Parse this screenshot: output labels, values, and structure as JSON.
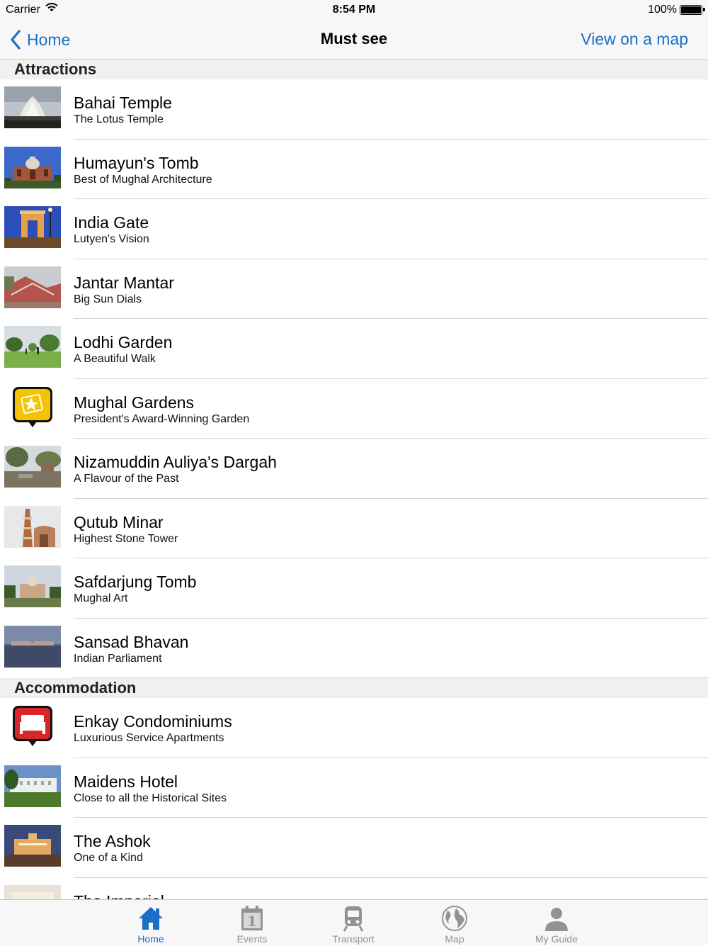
{
  "status": {
    "carrier": "Carrier",
    "time": "8:54 PM",
    "battery": "100%"
  },
  "nav": {
    "back_label": "Home",
    "title": "Must see",
    "right_label": "View on a map"
  },
  "sections": [
    {
      "title": "Attractions",
      "items": [
        {
          "title": "Bahai Temple",
          "subtitle": "The Lotus Temple",
          "thumb": "lotus-temple-photo"
        },
        {
          "title": "Humayun's Tomb",
          "subtitle": "Best of Mughal Architecture",
          "thumb": "humayun-tomb-photo"
        },
        {
          "title": "India Gate",
          "subtitle": "Lutyen's Vision",
          "thumb": "india-gate-photo"
        },
        {
          "title": "Jantar Mantar",
          "subtitle": "Big Sun Dials",
          "thumb": "jantar-mantar-photo"
        },
        {
          "title": "Lodhi Garden",
          "subtitle": "A Beautiful Walk",
          "thumb": "lodhi-garden-photo"
        },
        {
          "title": "Mughal Gardens",
          "subtitle": "President's Award-Winning Garden",
          "thumb": "attraction-pin-icon"
        },
        {
          "title": "Nizamuddin Auliya's Dargah",
          "subtitle": "A Flavour of the Past",
          "thumb": "dargah-photo"
        },
        {
          "title": "Qutub Minar",
          "subtitle": "Highest Stone Tower",
          "thumb": "qutub-minar-photo"
        },
        {
          "title": "Safdarjung Tomb",
          "subtitle": "Mughal Art",
          "thumb": "safdarjung-tomb-photo"
        },
        {
          "title": "Sansad Bhavan",
          "subtitle": "Indian Parliament",
          "thumb": "parliament-photo"
        }
      ]
    },
    {
      "title": "Accommodation",
      "items": [
        {
          "title": "Enkay Condominiums",
          "subtitle": "Luxurious Service Apartments",
          "thumb": "hotel-bed-pin-icon"
        },
        {
          "title": "Maidens Hotel",
          "subtitle": "Close to all the Historical Sites",
          "thumb": "maidens-hotel-photo"
        },
        {
          "title": "The Ashok",
          "subtitle": "One of a Kind",
          "thumb": "ashok-hotel-photo"
        },
        {
          "title": "The Imperial",
          "subtitle": "",
          "thumb": "imperial-hotel-photo"
        }
      ]
    }
  ],
  "tabs": [
    {
      "label": "Home",
      "icon": "home-icon",
      "active": true
    },
    {
      "label": "Events",
      "icon": "calendar-icon",
      "active": false
    },
    {
      "label": "Transport",
      "icon": "train-icon",
      "active": false
    },
    {
      "label": "Map",
      "icon": "globe-icon",
      "active": false
    },
    {
      "label": "My Guide",
      "icon": "person-icon",
      "active": false
    }
  ],
  "colors": {
    "accent": "#1a6fc9",
    "tab_inactive": "#929292",
    "attraction_pin": "#f5c400",
    "hotel_pin": "#d8262a"
  }
}
